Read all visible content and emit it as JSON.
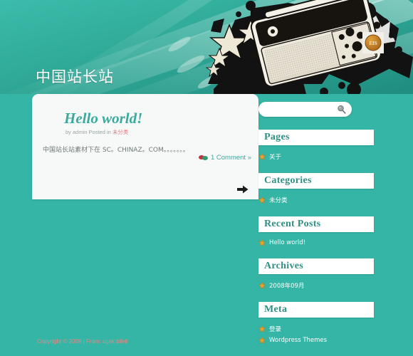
{
  "site": {
    "title": "中国站长站",
    "background_color": "#35b5a6",
    "accent_color": "#3aaa9c"
  },
  "post": {
    "title": "Hello world!",
    "meta_prefix": "by admin Posted in ",
    "meta_category": "未分类",
    "body": "中国站长站素材下在 SC。CHINAZ。COM。。。。。。。",
    "comments_label": "1 Comment »",
    "comment_icon": "comment-bubble-icon",
    "next_icon": "arrow-right-icon"
  },
  "search": {
    "value": "",
    "placeholder": "",
    "icon": "magnifier-icon"
  },
  "sidebar": {
    "widgets": [
      {
        "title": "Pages",
        "items": [
          {
            "label": "关于",
            "icon": "star-bullet-icon"
          }
        ]
      },
      {
        "title": "Categories",
        "items": [
          {
            "label": "未分类",
            "icon": "star-bullet-icon"
          }
        ]
      },
      {
        "title": "Recent Posts",
        "items": [
          {
            "label": "Hello world!",
            "icon": "star-bullet-icon"
          }
        ]
      },
      {
        "title": "Archives",
        "items": [
          {
            "label": "2008年09月",
            "icon": "star-bullet-icon"
          }
        ]
      },
      {
        "title": "Meta",
        "items": [
          {
            "label": "登录",
            "icon": "star-bullet-icon"
          },
          {
            "label": "Wordpress Themes",
            "icon": "star-bullet-icon"
          }
        ]
      }
    ]
  },
  "footer": {
    "text": "Copyright © 2009 | From: uçak bileti"
  }
}
